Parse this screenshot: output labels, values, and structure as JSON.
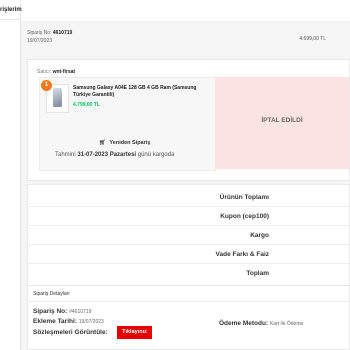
{
  "sidebar": {
    "title": "rişlerim"
  },
  "order": {
    "number_label": "Sipariş No:",
    "number": "4610719",
    "date": "19/07/2023",
    "total": "4.699,00 TL"
  },
  "seller": {
    "label": "Satıcı:",
    "name": "wnt-firsat"
  },
  "item": {
    "quantity": "1",
    "name": "Samsung Galaxy A04E 128 GB 4 GB Ram (Samsung Türkiye Garantili)",
    "price": "4.799,00 TL",
    "status": "İPTAL EDİLDİ",
    "reorder_label": "Yeniden Sipariş",
    "delivery_prefix": "Tahmini",
    "delivery_date": "31-07-2023 Pazartesi",
    "delivery_suffix": "günü kargoda"
  },
  "summary": {
    "rows": [
      "Ürünün Toplamı",
      "Kupon (cep100)",
      "Kargo",
      "Vade Farkı & Faiz",
      "Toplam"
    ]
  },
  "details": {
    "title": "Sipariş Detayları",
    "order_no_label": "Sipariş No:",
    "order_no": "#4610719",
    "added_label": "Ekleme Tarihi:",
    "added_date": "19/07/2023",
    "contracts_label": "Sözleşmeleri Görüntüle:",
    "contracts_button": "Tıklayınız",
    "payment_label": "Ödeme Metodu:",
    "payment_value": "Kart ile Ödeme"
  },
  "colors": {
    "accent_orange": "#f27a1a",
    "price_green": "#0bc15c",
    "cancel_bg": "#fbe3e3",
    "button_red": "#e60000"
  }
}
